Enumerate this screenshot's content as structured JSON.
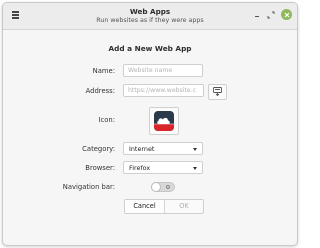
{
  "window": {
    "title": "Web Apps",
    "subtitle": "Run websites as if they were apps",
    "menu_icon": "hamburger-menu-icon",
    "controls": {
      "minimize": "minimize-icon",
      "maximize": "maximize-icon",
      "close": "close-icon"
    }
  },
  "form": {
    "heading": "Add a New Web App",
    "name": {
      "label": "Name:",
      "value": "",
      "placeholder": "Website name"
    },
    "address": {
      "label": "Address:",
      "value": "",
      "placeholder": "https://www.website.c",
      "favicon_button_icon": "download-favicon-icon"
    },
    "icon": {
      "label": "Icon:",
      "image": "webapp-cloud-icon"
    },
    "category": {
      "label": "Category:",
      "selected": "Internet"
    },
    "browser": {
      "label": "Browser:",
      "selected": "Firefox"
    },
    "navigation_bar": {
      "label": "Navigation bar:",
      "enabled": false
    }
  },
  "buttons": {
    "cancel": "Cancel",
    "ok": "OK"
  },
  "colors": {
    "close_button": "#8fb85c",
    "icon_background": "#2b3a4a",
    "icon_accent": "#d9262a"
  }
}
